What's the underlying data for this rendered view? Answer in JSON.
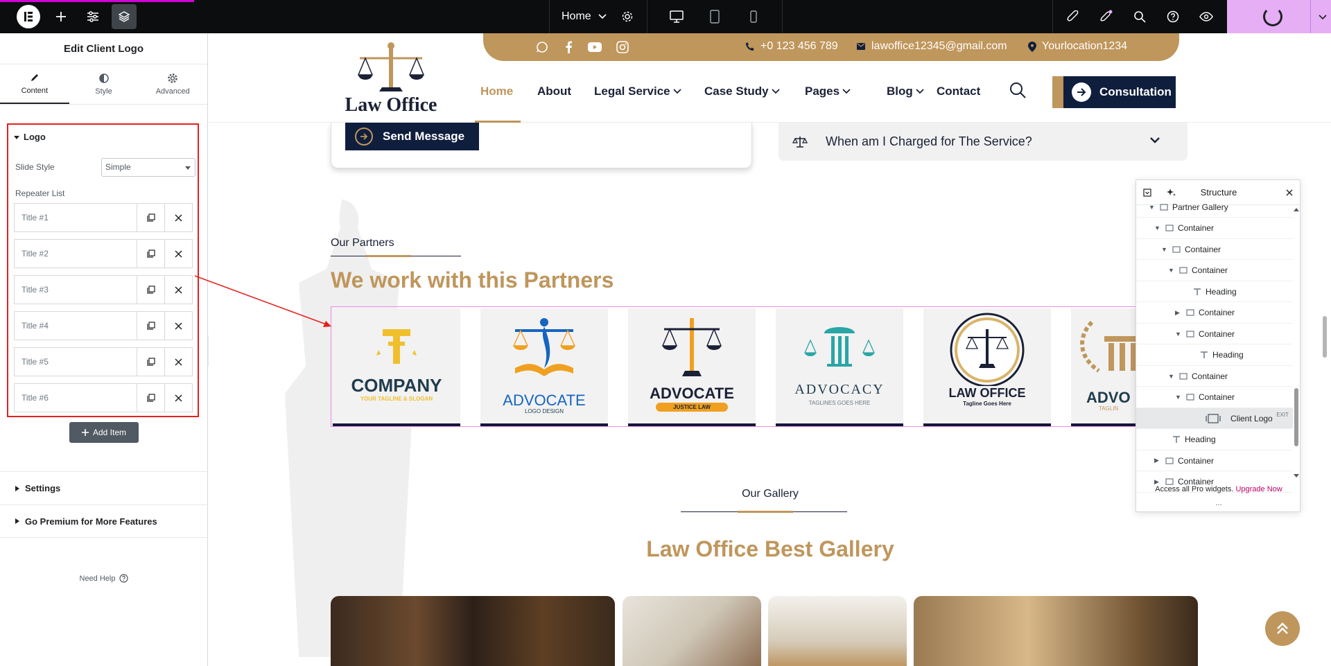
{
  "topbar": {
    "page_name": "Home",
    "icons": [
      "elementor-logo-icon",
      "add-icon",
      "settings-sliders-icon",
      "layers-icon",
      "settings-gear-icon",
      "desktop-icon",
      "tablet-icon",
      "mobile-icon",
      "rocket-icon",
      "notifications-icon",
      "search-icon",
      "help-icon",
      "preview-eye-icon",
      "chevron-down-icon"
    ],
    "accent": "#d004d4",
    "publish_color": "#e6aef5"
  },
  "panel": {
    "title": "Edit Client Logo",
    "tabs": [
      {
        "label": "Content",
        "icon": "pencil-icon",
        "active": true
      },
      {
        "label": "Style",
        "icon": "contrast-icon",
        "active": false
      },
      {
        "label": "Advanced",
        "icon": "gear-icon",
        "active": false
      }
    ],
    "logo_section": {
      "heading": "Logo",
      "slide_style_label": "Slide Style",
      "slide_style_value": "Simple",
      "repeater_label": "Repeater List",
      "items": [
        "Title #1",
        "Title #2",
        "Title #3",
        "Title #4",
        "Title #5",
        "Title #6"
      ],
      "add_item": "Add Item"
    },
    "settings": "Settings",
    "premium": "Go Premium for More Features",
    "need_help": "Need Help",
    "highlight_color": "#e4201e"
  },
  "site": {
    "phone": "+0 123 456 789",
    "email": "lawoffice12345@gmail.com",
    "location": "Yourlocation1234",
    "logo_text": "Law Office",
    "nav": [
      {
        "label": "Home",
        "active": true,
        "dropdown": false
      },
      {
        "label": "About",
        "active": false,
        "dropdown": false
      },
      {
        "label": "Legal Service",
        "active": false,
        "dropdown": true
      },
      {
        "label": "Case Study",
        "active": false,
        "dropdown": true
      },
      {
        "label": "Pages",
        "active": false,
        "dropdown": true
      },
      {
        "label": "Blog",
        "active": false,
        "dropdown": true
      },
      {
        "label": "Contact",
        "active": false,
        "dropdown": false
      }
    ],
    "cta": "Consultation",
    "send_message": "Send Message",
    "faq_question": "When am I Charged for The Service?",
    "partners_label": "Our Partners",
    "partners_title": "We work with this Partners",
    "partner_logos": [
      {
        "name": "COMPANY",
        "tagline": "YOUR TAGLINE & SLOGAN"
      },
      {
        "name": "ADVOCATE",
        "tagline": "LOGO DESIGN"
      },
      {
        "name": "ADVOCATE",
        "tagline": "JUSTICE LAW"
      },
      {
        "name": "ADVOCACY",
        "tagline": "TAGLINES GOES HERE"
      },
      {
        "name": "LAW OFFICE",
        "tagline": "Tagline Goes Here"
      },
      {
        "name": "ADVO",
        "tagline": "TAGLIN"
      }
    ],
    "gallery_label": "Our Gallery",
    "gallery_title": "Law Office Best Gallery",
    "brand_color": "#bf965c",
    "dark_color": "#0f1e3d"
  },
  "structure": {
    "title": "Structure",
    "rows": [
      {
        "label": "Partner Gallery",
        "type": "container",
        "expanded": true
      },
      {
        "label": "Container",
        "type": "container",
        "expanded": true
      },
      {
        "label": "Container",
        "type": "container",
        "expanded": true
      },
      {
        "label": "Container",
        "type": "container",
        "expanded": true
      },
      {
        "label": "Heading",
        "type": "heading",
        "expanded": false
      },
      {
        "label": "Container",
        "type": "container",
        "expanded": false
      },
      {
        "label": "Container",
        "type": "container",
        "expanded": true
      },
      {
        "label": "Heading",
        "type": "heading",
        "expanded": false
      },
      {
        "label": "Container",
        "type": "container",
        "expanded": true
      },
      {
        "label": "Container",
        "type": "container",
        "expanded": true
      },
      {
        "label": "Client Logo",
        "type": "widget",
        "selected": true,
        "badge": "EXIT"
      },
      {
        "label": "Heading",
        "type": "heading",
        "expanded": false
      },
      {
        "label": "Container",
        "type": "container",
        "expanded": false
      },
      {
        "label": "Container",
        "type": "container",
        "expanded": false
      }
    ],
    "footer_text": "Access all Pro widgets.",
    "footer_link": "Upgrade Now",
    "more": "..."
  }
}
